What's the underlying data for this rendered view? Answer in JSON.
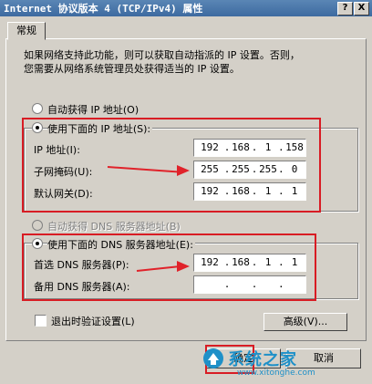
{
  "window": {
    "title": "Internet 协议版本 4 (TCP/IPv4) 属性",
    "help_btn": "?",
    "close_btn": "X"
  },
  "tabs": [
    "常规"
  ],
  "description": [
    "如果网络支持此功能，则可以获取自动指派的 IP 设置。否则，",
    "您需要从网络系统管理员处获得适当的 IP 设置。"
  ],
  "ip": {
    "auto_label": "自动获得 IP 地址(O)",
    "manual_label": "使用下面的 IP 地址(S):",
    "fields": [
      {
        "label": "IP 地址(I):",
        "octets": [
          "192",
          "168",
          "1",
          "158"
        ]
      },
      {
        "label": "子网掩码(U):",
        "octets": [
          "255",
          "255",
          "255",
          "0"
        ]
      },
      {
        "label": "默认网关(D):",
        "octets": [
          "192",
          "168",
          "1",
          "1"
        ]
      }
    ]
  },
  "dns": {
    "auto_label": "自动获得 DNS 服务器地址(B)",
    "manual_label": "使用下面的 DNS 服务器地址(E):",
    "fields": [
      {
        "label": "首选 DNS 服务器(P):",
        "octets": [
          "192",
          "168",
          "1",
          "1"
        ]
      },
      {
        "label": "备用 DNS 服务器(A):",
        "octets": [
          "",
          "",
          "",
          ""
        ]
      }
    ]
  },
  "validate_label": "退出时验证设置(L)",
  "advanced_label": "高级(V)...",
  "bottom_buttons": {
    "ok_label": "确定",
    "cancel_label": "取消"
  },
  "watermark": {
    "text": "系统之家",
    "url": "www.xitonghe.com"
  },
  "colors": {
    "annotation": "#d81c24",
    "titlebar": "#3d6aa0",
    "dialog": "#d4d0c8"
  }
}
